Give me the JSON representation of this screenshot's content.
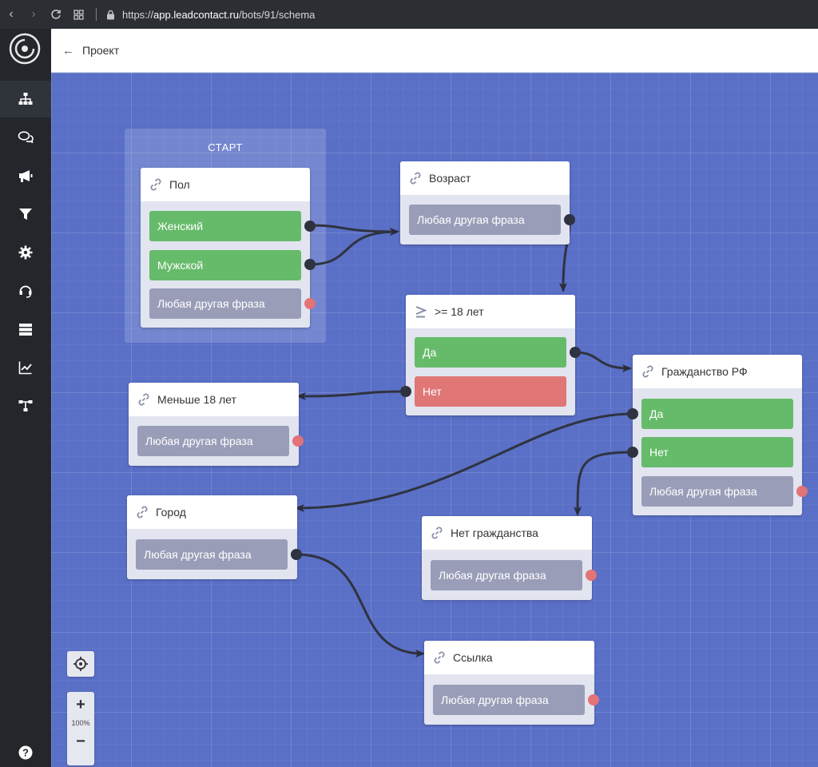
{
  "browser": {
    "url_host": "app.leadcontact.ru",
    "url_path": "/bots/91/schema",
    "url_scheme": "https://"
  },
  "header": {
    "back_arrow": "←",
    "title": "Проект"
  },
  "sidebar": {
    "items": [
      {
        "name": "schema",
        "icon": "hierarchy-icon"
      },
      {
        "name": "dialogs",
        "icon": "chat-icon"
      },
      {
        "name": "broadcasts",
        "icon": "megaphone-icon"
      },
      {
        "name": "filters",
        "icon": "funnel-icon"
      },
      {
        "name": "settings",
        "icon": "gear-icon"
      },
      {
        "name": "support",
        "icon": "headset-icon"
      },
      {
        "name": "storage",
        "icon": "server-icon"
      },
      {
        "name": "analytics",
        "icon": "chart-icon"
      },
      {
        "name": "integrations",
        "icon": "network-icon"
      },
      {
        "name": "help",
        "icon": "help-icon"
      }
    ]
  },
  "canvas": {
    "group_title": "СТАРТ",
    "zoom_level": "100%",
    "zoom_in": "+",
    "zoom_out": "−",
    "nodes": {
      "pol": {
        "title": "Пол",
        "options": [
          "Женский",
          "Мужской",
          "Любая другая фраза"
        ]
      },
      "vozrast": {
        "title": "Возраст",
        "options": [
          "Любая другая фраза"
        ]
      },
      "age18": {
        "title": ">= 18 лет",
        "options": [
          "Да",
          "Нет"
        ]
      },
      "grazhd": {
        "title": "Гражданство РФ",
        "options": [
          "Да",
          "Нет",
          "Любая другая фраза"
        ]
      },
      "menshe": {
        "title": "Меньше 18 лет",
        "options": [
          "Любая другая фраза"
        ]
      },
      "gorod": {
        "title": "Город",
        "options": [
          "Любая другая фраза"
        ]
      },
      "net_grazhd": {
        "title": "Нет гражданства",
        "options": [
          "Любая другая фраза"
        ]
      },
      "ssylka": {
        "title": "Ссылка",
        "options": [
          "Любая другая фраза"
        ]
      }
    }
  },
  "colors": {
    "canvas_bg": "#5a6fc6",
    "option_green": "#66bb6a",
    "option_gray": "#9a9db8",
    "option_red": "#e07676",
    "port_dark": "#2f3340",
    "port_open": "#e27377"
  }
}
